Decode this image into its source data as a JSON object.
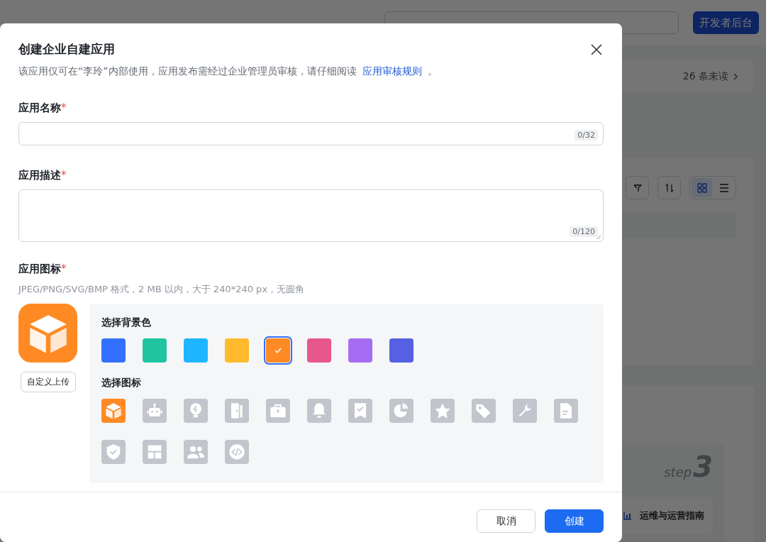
{
  "top_nav": {
    "console_button": "开发者后台"
  },
  "notice": {
    "unread": "26 条未读"
  },
  "view_toggle": [
    {
      "kind": "grid",
      "selected": true
    },
    {
      "kind": "list",
      "selected": false
    }
  ],
  "guide": {
    "step_label": "step",
    "step_number": "3",
    "title": "运维与运营指南"
  },
  "dialog": {
    "title": "创建企业自建应用",
    "description": "该应用仅可在“李玲”内部使用，应用发布需经过企业管理员审核，请仔细阅读",
    "link": "应用审核规则",
    "description_end": "。",
    "fields": [
      {
        "kind": "input",
        "label": "应用名称",
        "required_mark": "*",
        "counter": "0/32"
      },
      {
        "kind": "textarea",
        "label": "应用描述",
        "required_mark": "*",
        "counter": "0/120"
      }
    ],
    "icon_picker": {
      "label": "应用图标",
      "required_mark": "*",
      "hint": "JPEG/PNG/SVG/BMP 格式，2 MB 以内，大于 240*240 px，无圆角",
      "upload_button": "自定义上传",
      "color_heading": "选择背景色",
      "icon_heading": "选择图标",
      "colors": [
        {
          "color": "#3370ff",
          "selected": false
        },
        {
          "color": "#20c5a0",
          "selected": false
        },
        {
          "color": "#1fb6ff",
          "selected": false
        },
        {
          "color": "#ffba2e",
          "selected": false
        },
        {
          "color": "#ff8a24",
          "selected": true
        },
        {
          "color": "#e8578a",
          "selected": false
        },
        {
          "color": "#a56ef2",
          "selected": false
        },
        {
          "color": "#5560e3",
          "selected": false
        }
      ],
      "icons": [
        {
          "kind": "cube",
          "selected": true
        },
        {
          "kind": "robot",
          "selected": false
        },
        {
          "kind": "lightbulb",
          "selected": false
        },
        {
          "kind": "door",
          "selected": false
        },
        {
          "kind": "briefcase",
          "selected": false
        },
        {
          "kind": "bell",
          "selected": false
        },
        {
          "kind": "bookmark",
          "selected": false
        },
        {
          "kind": "pie-chart",
          "selected": false
        },
        {
          "kind": "star",
          "selected": false
        },
        {
          "kind": "tag",
          "selected": false
        },
        {
          "kind": "wrench",
          "selected": false
        },
        {
          "kind": "document",
          "selected": false
        },
        {
          "kind": "shield",
          "selected": false
        },
        {
          "kind": "layout",
          "selected": false
        },
        {
          "kind": "people",
          "selected": false
        },
        {
          "kind": "code",
          "selected": false
        }
      ]
    },
    "buttons": [
      {
        "kind": "secondary",
        "label": "取消"
      },
      {
        "kind": "primary",
        "label": "创建"
      }
    ]
  }
}
